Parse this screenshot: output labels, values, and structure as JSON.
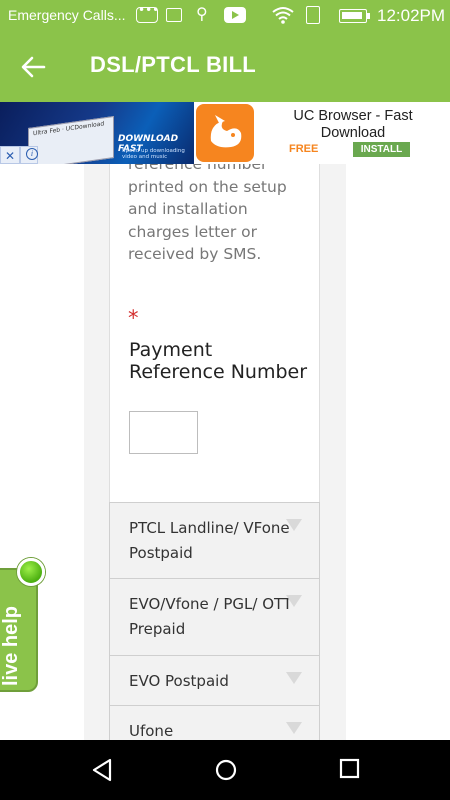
{
  "status_bar": {
    "notification_text": "Emergency Calls...",
    "clock": "12:02PM",
    "icons": [
      "more-notifications-icon",
      "image-icon",
      "usb-icon",
      "youtube-icon",
      "wifi-icon",
      "sim-icon",
      "battery-icon"
    ]
  },
  "app_bar": {
    "back_icon": "arrow-left-icon",
    "title": "DSL/PTCL BILL",
    "color": "#8bc34a"
  },
  "ad": {
    "image_caption": "DOWNLOAD FAST",
    "image_subcaption": "Speed up downloading video and music",
    "app_name": "UC Browser - Fast Download",
    "price": "FREE",
    "install_label": "INSTALL",
    "close_label": "✕"
  },
  "form": {
    "help_text": "reference number printed on the setup and installation charges letter or received by SMS.",
    "required_marker": "*",
    "field_label": "Payment Reference Number",
    "field_value": ""
  },
  "accordion": {
    "items": [
      {
        "label": "PTCL Landline/ VFone Postpaid"
      },
      {
        "label": "EVO/Vfone / PGL/ OTT Prepaid"
      },
      {
        "label": "EVO Postpaid"
      },
      {
        "label": "Ufone"
      }
    ]
  },
  "live_help": {
    "label": "live help"
  },
  "nav_bar": {
    "icons": [
      "back-triangle-icon",
      "home-circle-icon",
      "recents-square-icon"
    ]
  }
}
